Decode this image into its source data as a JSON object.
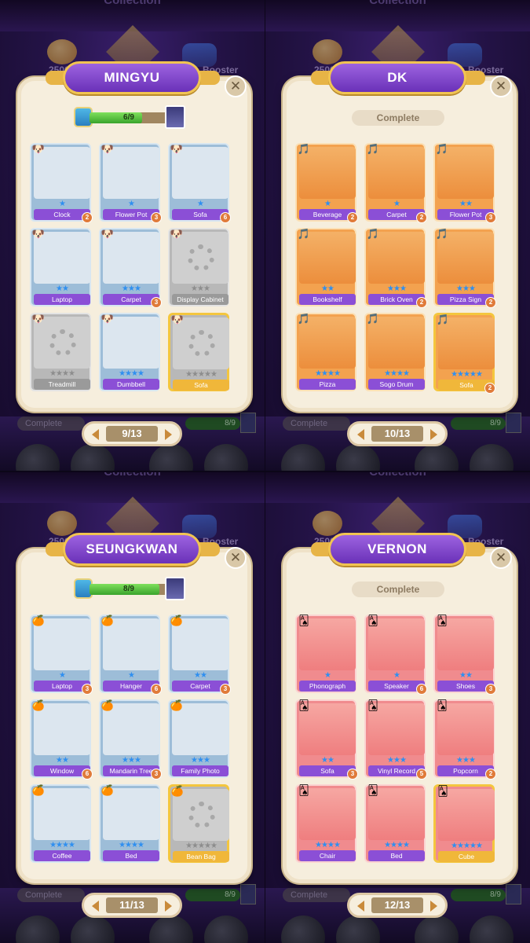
{
  "background": {
    "title": "Collection",
    "coin_label": "2500",
    "booster_label": "Booster",
    "complete_label": "Complete",
    "progress_label": "8/9"
  },
  "screens": [
    {
      "name": "MINGYU",
      "complete": false,
      "progress_text": "6/9",
      "progress_fraction": 0.6667,
      "tag_icon": "puppy-icon",
      "page": "9/13",
      "cards": [
        {
          "label": "Clock",
          "stars": "★",
          "count": "2",
          "theme": "t-blue",
          "locked": false,
          "gold": false
        },
        {
          "label": "Flower Pot",
          "stars": "★",
          "count": "3",
          "theme": "t-blue",
          "locked": false,
          "gold": false
        },
        {
          "label": "Sofa",
          "stars": "★",
          "count": "6",
          "theme": "t-blue",
          "locked": false,
          "gold": false
        },
        {
          "label": "Laptop",
          "stars": "★★",
          "count": "",
          "theme": "t-blue",
          "locked": false,
          "gold": false
        },
        {
          "label": "Carpet",
          "stars": "★★★",
          "count": "3",
          "theme": "t-blue",
          "locked": false,
          "gold": false
        },
        {
          "label": "Display Cabinet",
          "stars": "★★★",
          "count": "",
          "theme": "t-gray",
          "locked": true,
          "gold": false
        },
        {
          "label": "Treadmill",
          "stars": "★★★★",
          "count": "",
          "theme": "t-gray",
          "locked": true,
          "gold": false
        },
        {
          "label": "Dumbbell",
          "stars": "★★★★",
          "count": "",
          "theme": "t-blue",
          "locked": false,
          "gold": false
        },
        {
          "label": "Sofa",
          "stars": "★★★★★",
          "count": "",
          "theme": "t-gray",
          "locked": true,
          "gold": true
        }
      ]
    },
    {
      "name": "DK",
      "complete": true,
      "complete_text": "Complete",
      "tag_icon": "whistle-icon",
      "page": "10/13",
      "cards": [
        {
          "label": "Beverage",
          "stars": "★",
          "count": "2",
          "theme": "t-orange",
          "locked": false,
          "gold": false
        },
        {
          "label": "Carpet",
          "stars": "★",
          "count": "2",
          "theme": "t-orange",
          "locked": false,
          "gold": false
        },
        {
          "label": "Flower Pot",
          "stars": "★★",
          "count": "3",
          "theme": "t-orange",
          "locked": false,
          "gold": false
        },
        {
          "label": "Bookshelf",
          "stars": "★★",
          "count": "",
          "theme": "t-orange",
          "locked": false,
          "gold": false
        },
        {
          "label": "Brick Oven",
          "stars": "★★★",
          "count": "2",
          "theme": "t-orange",
          "locked": false,
          "gold": false
        },
        {
          "label": "Pizza Sign",
          "stars": "★★★",
          "count": "2",
          "theme": "t-orange",
          "locked": false,
          "gold": false
        },
        {
          "label": "Pizza",
          "stars": "★★★★",
          "count": "",
          "theme": "t-orange",
          "locked": false,
          "gold": false
        },
        {
          "label": "Sogo Drum",
          "stars": "★★★★",
          "count": "",
          "theme": "t-orange",
          "locked": false,
          "gold": false
        },
        {
          "label": "Sofa",
          "stars": "★★★★★",
          "count": "2",
          "theme": "t-orange",
          "locked": false,
          "gold": true
        }
      ]
    },
    {
      "name": "SEUNGKWAN",
      "complete": false,
      "progress_text": "8/9",
      "progress_fraction": 0.8889,
      "tag_icon": "tangerine-icon",
      "page": "11/13",
      "cards": [
        {
          "label": "Laptop",
          "stars": "★",
          "count": "3",
          "theme": "t-blue",
          "locked": false,
          "gold": false
        },
        {
          "label": "Hanger",
          "stars": "★",
          "count": "6",
          "theme": "t-blue",
          "locked": false,
          "gold": false
        },
        {
          "label": "Carpet",
          "stars": "★★",
          "count": "3",
          "theme": "t-blue",
          "locked": false,
          "gold": false
        },
        {
          "label": "Window",
          "stars": "★★",
          "count": "6",
          "theme": "t-blue",
          "locked": false,
          "gold": false
        },
        {
          "label": "Mandarin Tree",
          "stars": "★★★",
          "count": "3",
          "theme": "t-blue",
          "locked": false,
          "gold": false
        },
        {
          "label": "Family Photo",
          "stars": "★★★",
          "count": "",
          "theme": "t-blue",
          "locked": false,
          "gold": false
        },
        {
          "label": "Coffee",
          "stars": "★★★★",
          "count": "",
          "theme": "t-blue",
          "locked": false,
          "gold": false
        },
        {
          "label": "Bed",
          "stars": "★★★★",
          "count": "",
          "theme": "t-blue",
          "locked": false,
          "gold": false
        },
        {
          "label": "Bean Bag",
          "stars": "★★★★★",
          "count": "",
          "theme": "t-gray",
          "locked": true,
          "gold": true
        }
      ]
    },
    {
      "name": "VERNON",
      "complete": true,
      "complete_text": "Complete",
      "tag_icon": "playing-card-icon",
      "page": "12/13",
      "cards": [
        {
          "label": "Phonograph",
          "stars": "★",
          "count": "",
          "theme": "t-pink",
          "locked": false,
          "gold": false
        },
        {
          "label": "Speaker",
          "stars": "★",
          "count": "6",
          "theme": "t-pink",
          "locked": false,
          "gold": false
        },
        {
          "label": "Shoes",
          "stars": "★★",
          "count": "3",
          "theme": "t-pink",
          "locked": false,
          "gold": false
        },
        {
          "label": "Sofa",
          "stars": "★★",
          "count": "3",
          "theme": "t-pink",
          "locked": false,
          "gold": false
        },
        {
          "label": "Vinyl Record",
          "stars": "★★★",
          "count": "5",
          "theme": "t-pink",
          "locked": false,
          "gold": false
        },
        {
          "label": "Popcorn",
          "stars": "★★★",
          "count": "2",
          "theme": "t-pink",
          "locked": false,
          "gold": false
        },
        {
          "label": "Chair",
          "stars": "★★★★",
          "count": "",
          "theme": "t-pink",
          "locked": false,
          "gold": false
        },
        {
          "label": "Bed",
          "stars": "★★★★",
          "count": "",
          "theme": "t-pink",
          "locked": false,
          "gold": false
        },
        {
          "label": "Cube",
          "stars": "★★★★★",
          "count": "",
          "theme": "t-pink",
          "locked": false,
          "gold": true
        }
      ]
    }
  ]
}
